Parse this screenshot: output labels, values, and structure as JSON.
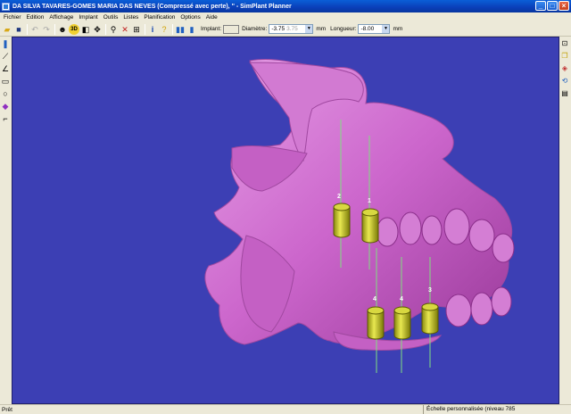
{
  "window": {
    "title": "DA SILVA TAVARES-GOMES MARIA DAS NEVES (Compressé avec perte), '' - SimPlant Planner"
  },
  "menu": [
    "Fichier",
    "Edition",
    "Affichage",
    "Implant",
    "Outils",
    "Listes",
    "Planification",
    "Options",
    "Aide"
  ],
  "toolbar": {
    "implant_label": "Implant:",
    "diameter_label": "Diamètre:",
    "diameter_value": "-3.75",
    "diameter_ghost": "3.75",
    "diameter_unit": "mm",
    "length_label": "Longueur:",
    "length_value": "-8.00",
    "length_unit": "mm",
    "btn_3d": "3D"
  },
  "viewport": {
    "background": "#3c3fb4",
    "model_color": "#cc66cc",
    "implant_color": "#c8c818",
    "implant_labels": [
      "2",
      "1",
      "4",
      "4",
      "3"
    ]
  },
  "status": {
    "left": "Prêt",
    "right": "Échelle personnalisée (niveau 785"
  }
}
